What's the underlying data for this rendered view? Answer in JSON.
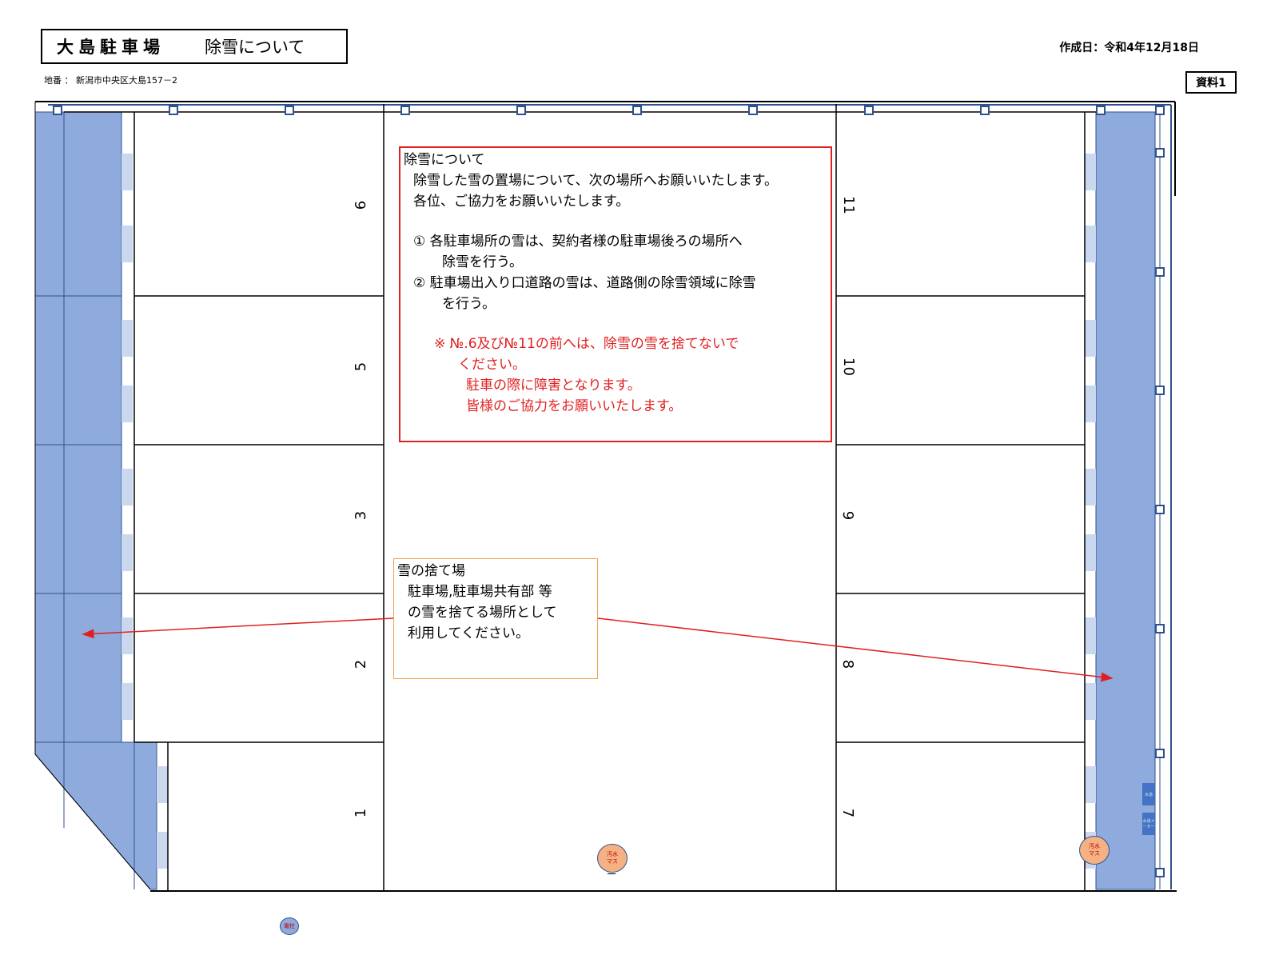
{
  "header": {
    "title_main": "大島駐車場",
    "title_sub": "除雪について",
    "created": "作成日：令和4年12月18日",
    "doc_label": "資料1",
    "address": "地番 ： 新潟市中央区大島157－2"
  },
  "notice": {
    "heading": "除雪について",
    "lines": [
      "除雪した雪の置場について、次の場所へお願いいたします。",
      "各位、ご協力をお願いいたします。"
    ],
    "item1_a": "①  各駐車場所の雪は、契約者様の駐車場後ろの場所へ",
    "item1_b": "除雪を行う。",
    "item2_a": "②  駐車場出入り口道路の雪は、道路側の除雪領域に除雪",
    "item2_b": "を行う。",
    "warn_a": "※  №.6及び№11の前へは、除雪の雪を捨てないで",
    "warn_b": "ください。",
    "warn_c": "駐車の際に障害となります。",
    "warn_d": "皆様のご協力をお願いいたします。"
  },
  "dump": {
    "heading": "雪の捨て場",
    "line1": "駐車場,駐車場共有部  等",
    "line2": "の雪を捨てる場所として",
    "line3": "利用してください。"
  },
  "spaces_left": [
    "6",
    "5",
    "3",
    "2",
    "1"
  ],
  "spaces_right": [
    "11",
    "10",
    "9",
    "8",
    "7"
  ],
  "manholes": [
    {
      "label_a": "汚水",
      "label_b": "マス"
    },
    {
      "label_a": "汚水",
      "label_b": "マス"
    }
  ],
  "pole_label": "電柱",
  "meters": [
    "水道",
    "水道メーター"
  ],
  "colors": {
    "snow_area": "#8faadc",
    "snow_border": "#2f528f",
    "notice_border": "#e02020",
    "dump_border": "#f0a050",
    "arrow": "#e02020"
  }
}
